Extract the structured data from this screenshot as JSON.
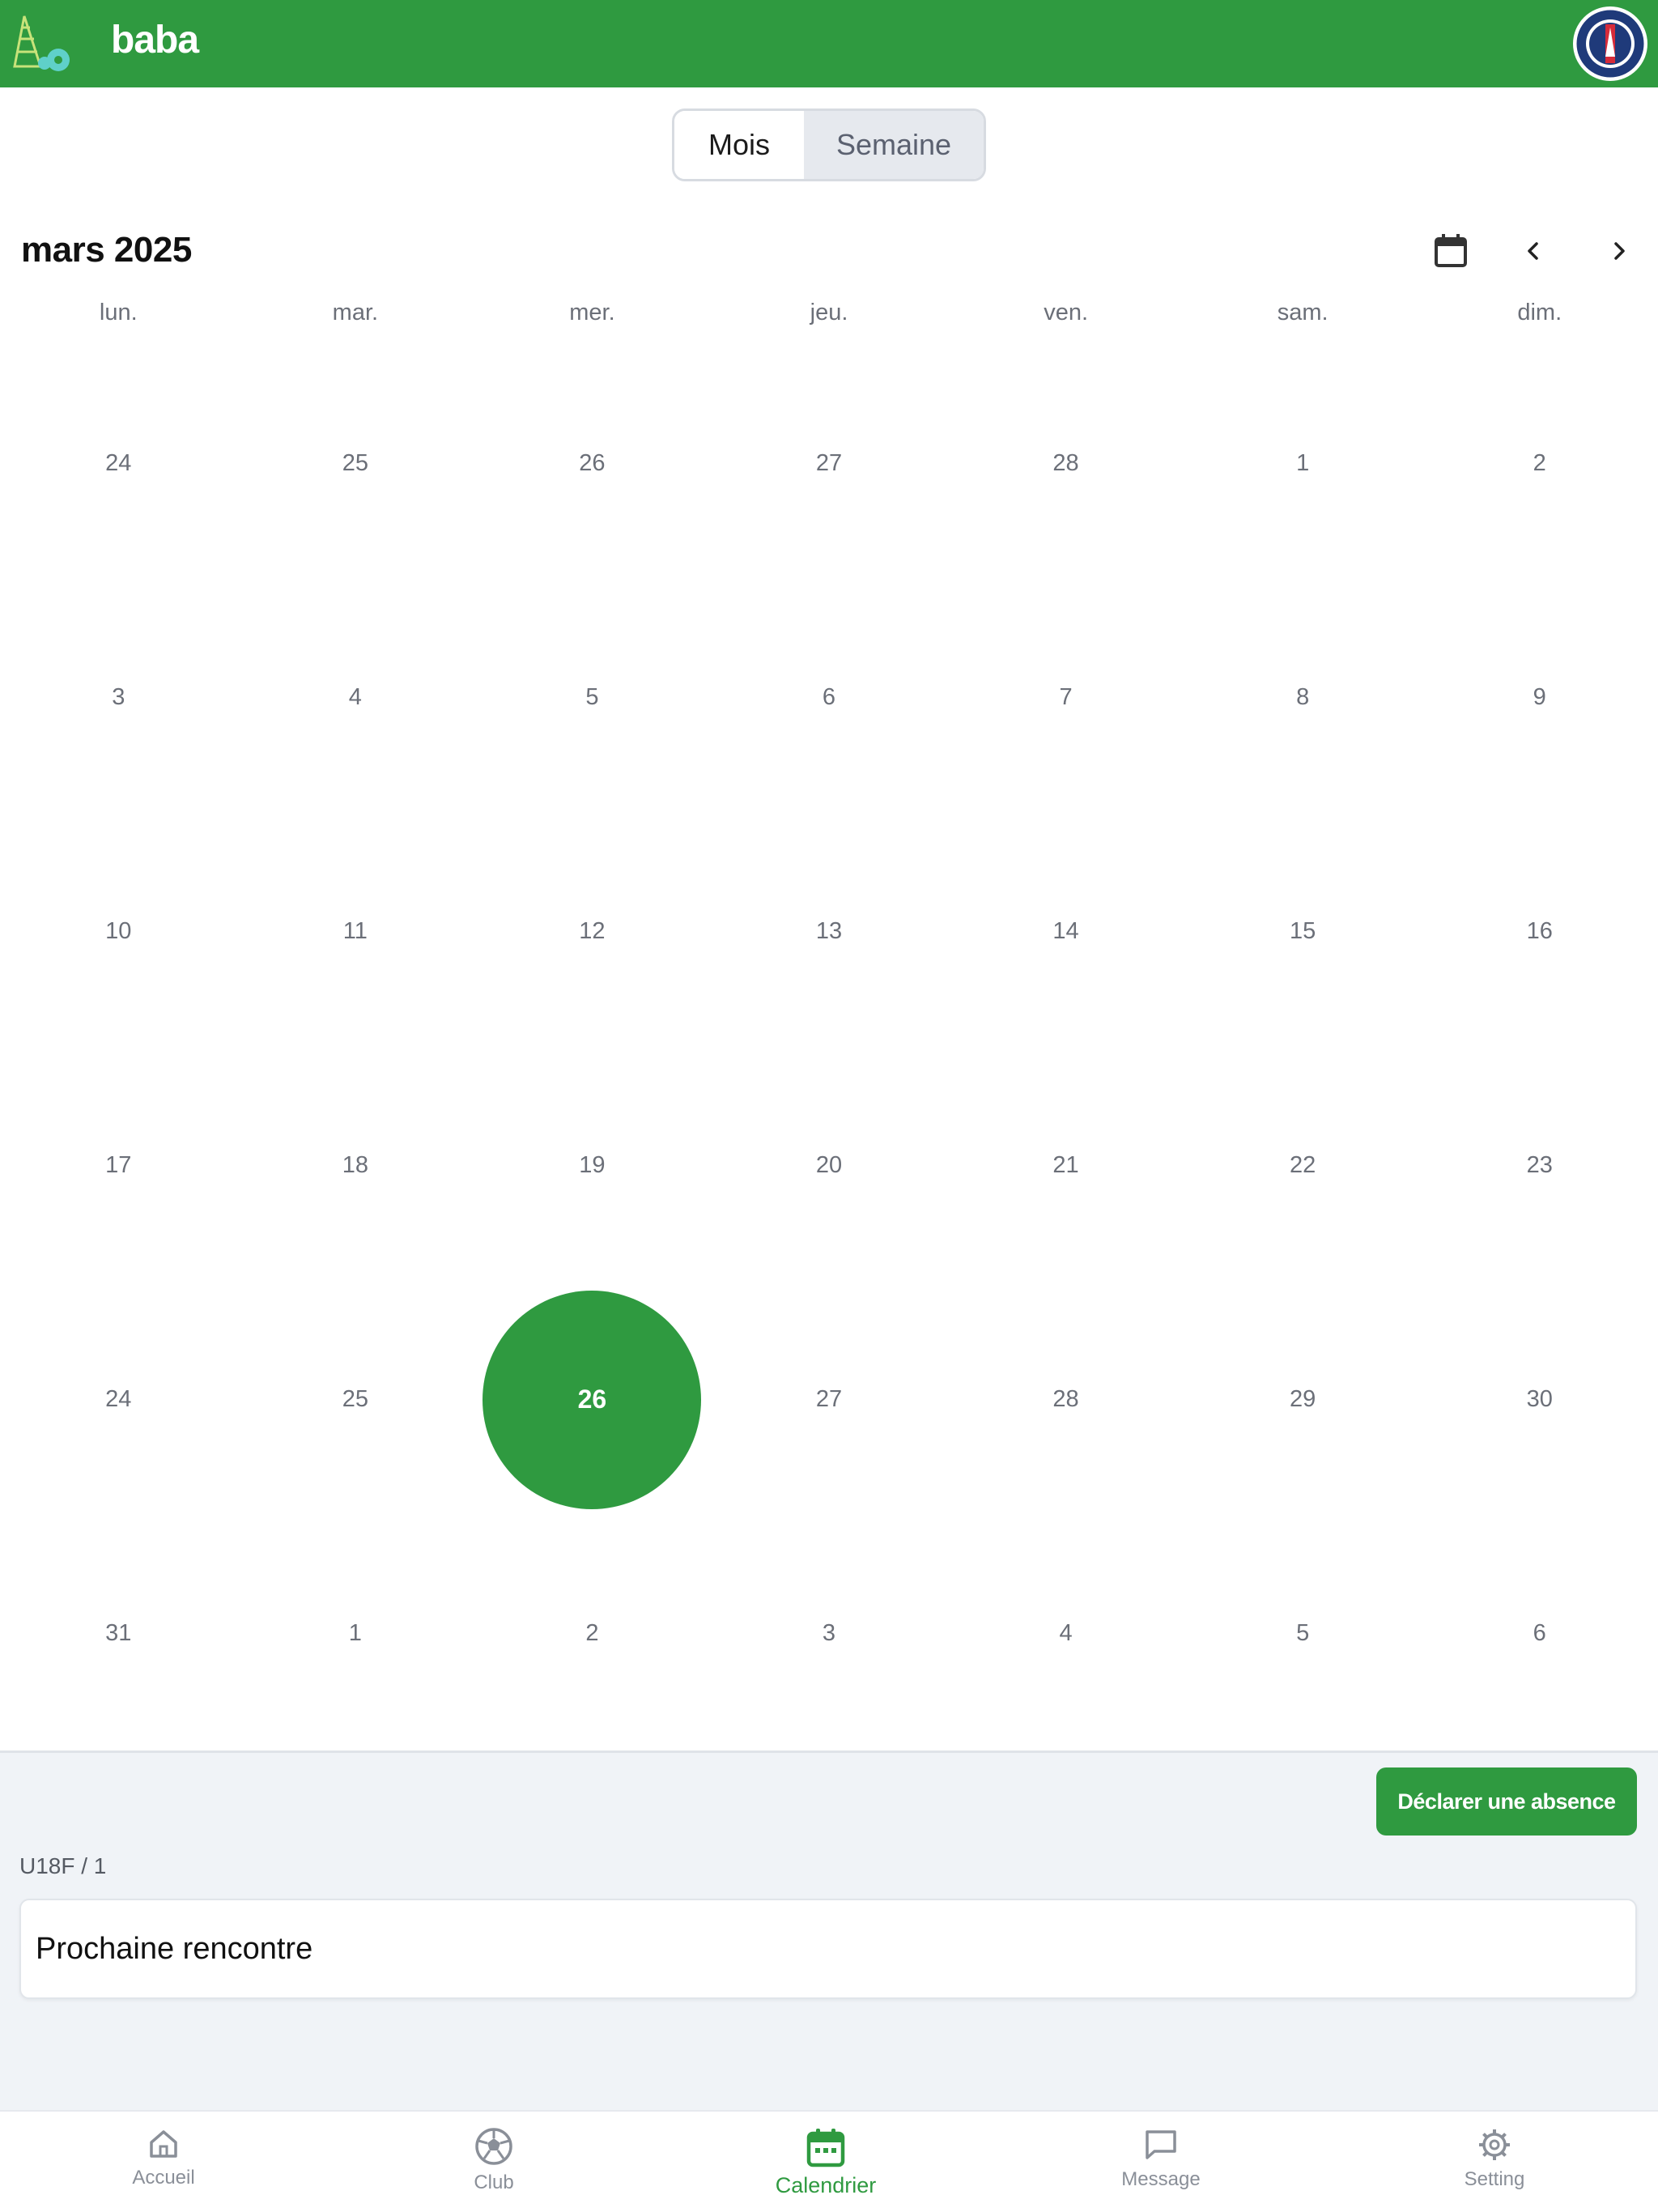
{
  "header": {
    "app_name": "baba",
    "logo_icon": "net-and-football-logo",
    "avatar_icon": "club-crest-avatar"
  },
  "view_toggle": {
    "options": [
      "Mois",
      "Semaine"
    ],
    "selected": "Mois"
  },
  "calendar": {
    "month_title": "mars 2025",
    "weekdays": [
      "lun.",
      "mar.",
      "mer.",
      "jeu.",
      "ven.",
      "sam.",
      "dim."
    ],
    "weeks": [
      [
        "24",
        "25",
        "26",
        "27",
        "28",
        "1",
        "2"
      ],
      [
        "3",
        "4",
        "5",
        "6",
        "7",
        "8",
        "9"
      ],
      [
        "10",
        "11",
        "12",
        "13",
        "14",
        "15",
        "16"
      ],
      [
        "17",
        "18",
        "19",
        "20",
        "21",
        "22",
        "23"
      ],
      [
        "24",
        "25",
        "26",
        "27",
        "28",
        "29",
        "30"
      ],
      [
        "31",
        "1",
        "2",
        "3",
        "4",
        "5",
        "6"
      ]
    ],
    "today": "26"
  },
  "panel": {
    "absence_button": "Déclarer une absence",
    "team_label": "U18F / 1",
    "next_match_title": "Prochaine rencontre"
  },
  "nav": {
    "items": [
      {
        "label": "Accueil",
        "icon": "home-icon"
      },
      {
        "label": "Club",
        "icon": "football-icon"
      },
      {
        "label": "Calendrier",
        "icon": "calendar-icon"
      },
      {
        "label": "Message",
        "icon": "message-icon"
      },
      {
        "label": "Setting",
        "icon": "gear-icon"
      }
    ],
    "active": "Calendrier"
  },
  "colors": {
    "accent": "#2f9a40",
    "panel_bg": "#f0f3f7",
    "muted_text": "#6b6f78"
  }
}
